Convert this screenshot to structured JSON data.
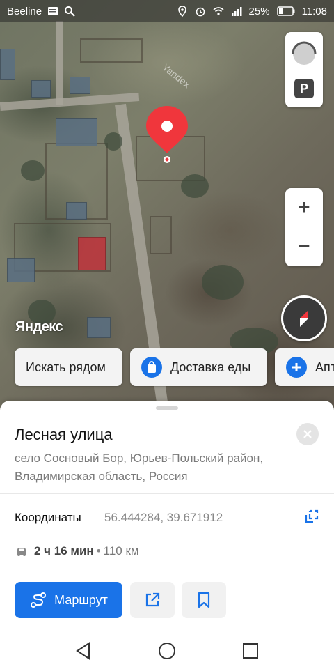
{
  "status_bar": {
    "carrier": "Beeline",
    "battery": "25%",
    "time": "11:08"
  },
  "map": {
    "watermark": "Yandex",
    "logo": "Яндекс",
    "parking_label": "P",
    "zoom_in": "+",
    "zoom_out": "−"
  },
  "chips": [
    {
      "label": "Искать рядом",
      "icon": ""
    },
    {
      "label": "Доставка еды",
      "icon": "shopping-bag-icon"
    },
    {
      "label": "Апт",
      "icon": "plus-icon"
    }
  ],
  "place": {
    "title": "Лесная улица",
    "address": "село Сосновый Бор, Юрьев-Польский район, Владимирская область, Россия",
    "coordinates_label": "Координаты",
    "coordinates_value": "56.444284, 39.671912",
    "travel_time": "2 ч 16 мин",
    "travel_separator": "•",
    "travel_distance": "110 км"
  },
  "actions": {
    "route_label": "Маршрут"
  },
  "colors": {
    "accent": "#1a73e8",
    "pin": "#f0363c"
  }
}
